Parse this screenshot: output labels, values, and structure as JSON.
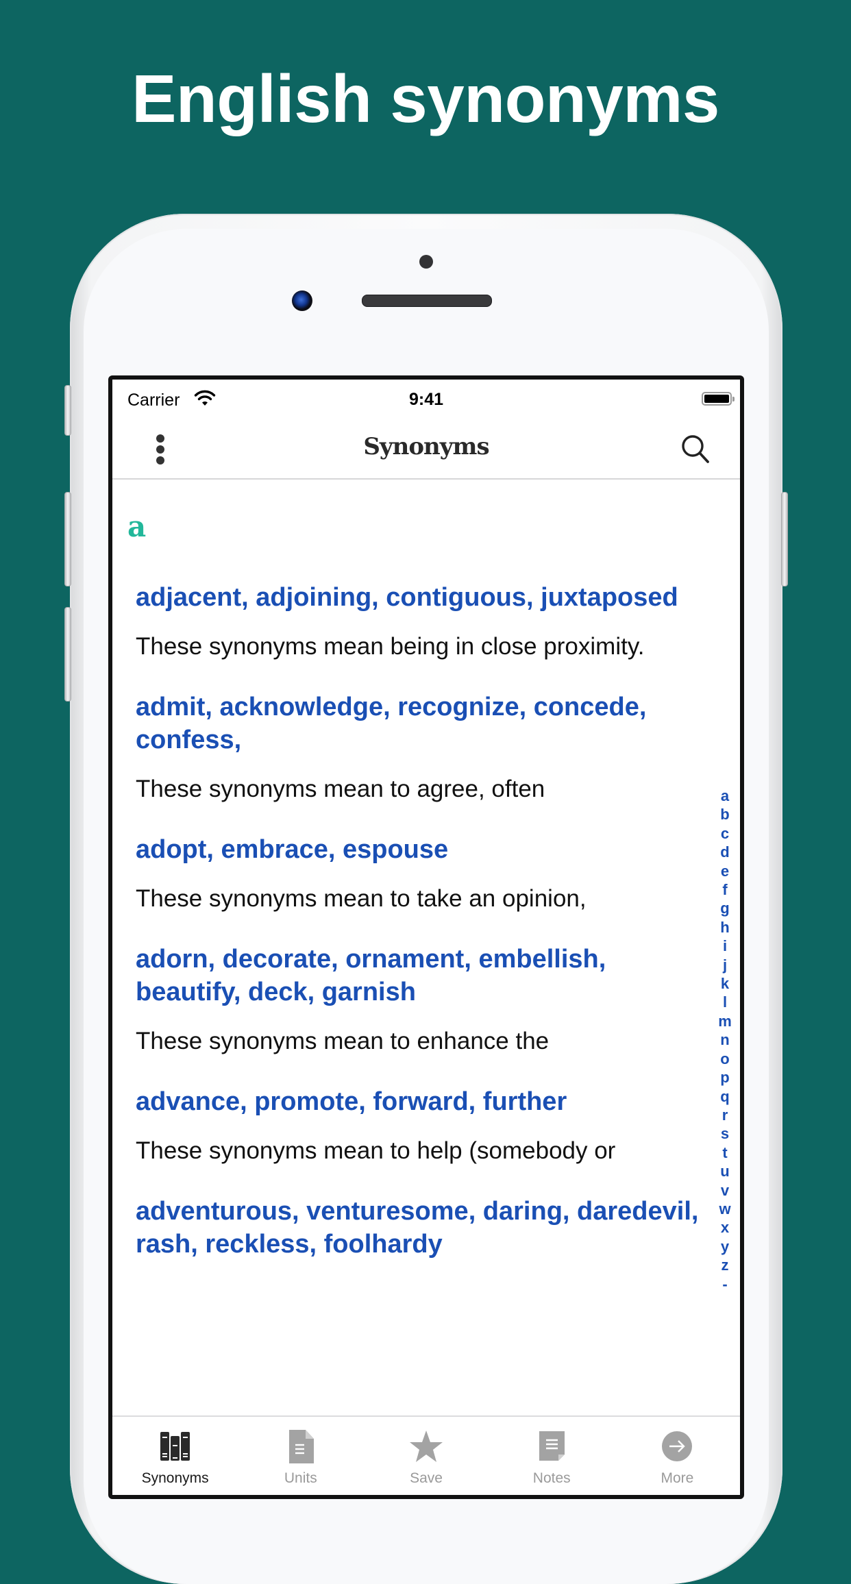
{
  "promo": {
    "headline": "English synonyms"
  },
  "status_bar": {
    "carrier": "Carrier",
    "time": "9:41",
    "wifi_icon": "wifi-icon",
    "battery_icon": "battery-full-icon"
  },
  "nav": {
    "title": "Synonyms",
    "menu_icon": "more-vertical-icon",
    "search_icon": "search-icon"
  },
  "colors": {
    "background": "#0d6561",
    "accent_green": "#22b79a",
    "link_blue": "#1a4fb4",
    "active_tab": "#1a1a1a",
    "inactive_tab": "#9a9a9a"
  },
  "list": {
    "section_letter": "a",
    "entries": [
      {
        "title": "adjacent, adjoining, contiguous, juxtaposed",
        "description": "These synonyms mean being in close proximity."
      },
      {
        "title": "admit, acknowledge, recognize, concede, confess,",
        "description": "These synonyms mean to agree, often"
      },
      {
        "title": "adopt, embrace, espouse",
        "description": "These synonyms mean to take an opinion,"
      },
      {
        "title": "adorn, decorate, ornament, embellish, beautify, deck, garnish",
        "description": "These synonyms mean to enhance the"
      },
      {
        "title": "advance, promote, forward, further",
        "description": "These synonyms mean to help (somebody or"
      },
      {
        "title": "adventurous, venturesome, daring, daredevil, rash, reckless, foolhardy",
        "description": ""
      }
    ]
  },
  "index_letters": [
    "a",
    "b",
    "c",
    "d",
    "e",
    "f",
    "g",
    "h",
    "i",
    "j",
    "k",
    "l",
    "m",
    "n",
    "o",
    "p",
    "q",
    "r",
    "s",
    "t",
    "u",
    "v",
    "w",
    "x",
    "y",
    "z",
    "-"
  ],
  "tabs": [
    {
      "label": "Synonyms",
      "icon": "books-icon",
      "active": true
    },
    {
      "label": "Units",
      "icon": "document-icon",
      "active": false
    },
    {
      "label": "Save",
      "icon": "star-icon",
      "active": false
    },
    {
      "label": "Notes",
      "icon": "note-icon",
      "active": false
    },
    {
      "label": "More",
      "icon": "arrow-circle-icon",
      "active": false
    }
  ]
}
